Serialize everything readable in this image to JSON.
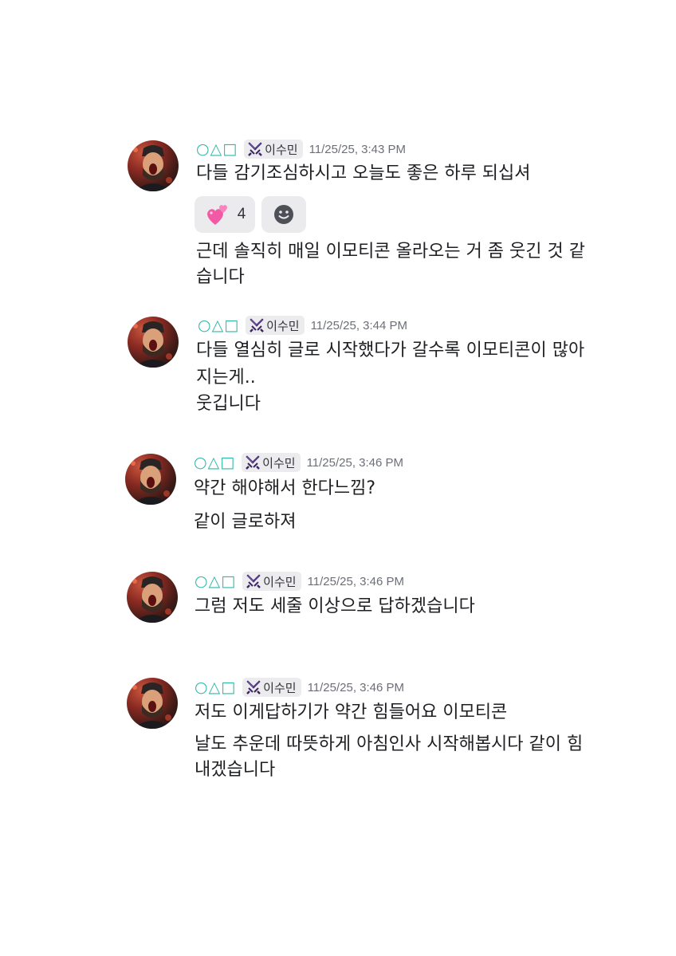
{
  "messages": [
    {
      "username": "○△□",
      "tag": "이수민",
      "timestamp": "11/25/25, 3:43 PM",
      "lines": [
        "다들 감기조심하시고 오늘도 좋은 하루 되십셔"
      ],
      "reaction": {
        "emoji": "two-hearts",
        "count": "4"
      },
      "followup_lines": [
        "근데 솔직히 매일 이모티콘 올라오는 거 좀 웃긴 것 같",
        "습니다"
      ]
    },
    {
      "username": "○△□",
      "tag": "이수민",
      "timestamp": "11/25/25, 3:44 PM",
      "lines": [
        "다들 열심히 글로 시작했다가 갈수록 이모티콘이 많아",
        "지는게..",
        "웃깁니다"
      ]
    },
    {
      "username": "○△□",
      "tag": "이수민",
      "timestamp": "11/25/25, 3:46 PM",
      "lines": [
        "약간 해야해서 한다느낌?",
        "같이 글로하져"
      ]
    },
    {
      "username": "○△□",
      "tag": "이수민",
      "timestamp": "11/25/25, 3:46 PM",
      "lines": [
        "그럼 저도 세줄 이상으로 답하겠습니다"
      ]
    },
    {
      "username": "○△□",
      "tag": "이수민",
      "timestamp": "11/25/25, 3:46 PM",
      "lines": [
        "저도 이게답하기가 약간 힘들어요 이모티콘",
        "날도 추운데 따뜻하게 아침인사 시작해봅시다 같이 힘",
        "내겠습니다"
      ]
    }
  ],
  "icons": {
    "tag_icon": "purple-sword-icon",
    "add_reaction_icon": "smiley-icon"
  },
  "colors": {
    "username": "#2fb8a8",
    "tag_bg": "#ececee",
    "reaction_bg": "#ebebed",
    "timestamp": "#6d6f78",
    "text": "#1e1f22"
  }
}
